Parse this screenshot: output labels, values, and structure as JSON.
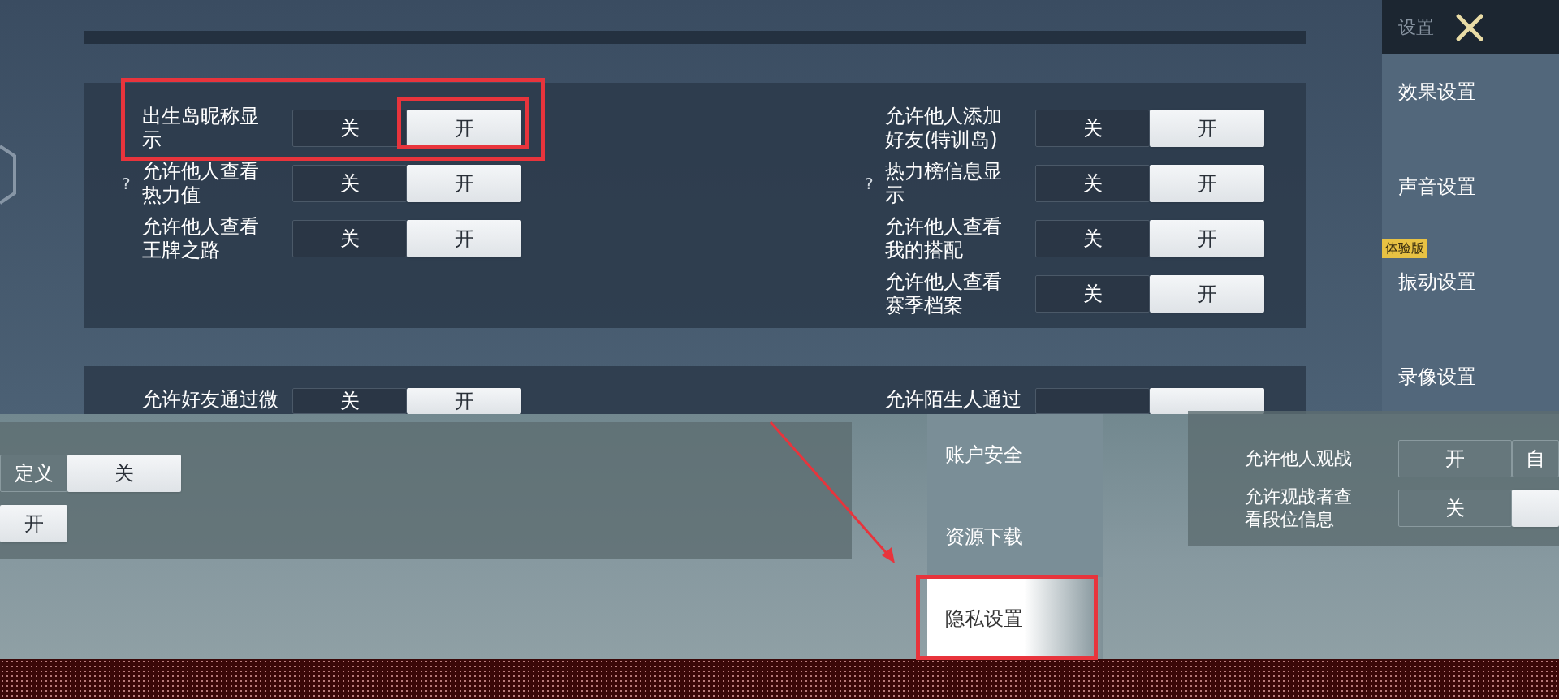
{
  "sidebar": {
    "title": "设置",
    "items": [
      {
        "label": "效果设置",
        "selected": false
      },
      {
        "label": "声音设置",
        "selected": false
      },
      {
        "label": "振动设置",
        "selected": false,
        "badge": "体验版"
      },
      {
        "label": "录像设置",
        "selected": false
      }
    ]
  },
  "privacy_panel": {
    "left_rows": [
      {
        "label": "出生岛昵称显示",
        "options": [
          {
            "label": "关",
            "selected": false
          },
          {
            "label": "开",
            "selected": true
          }
        ]
      },
      {
        "label": "允许他人查看热力值",
        "help": "?",
        "options": [
          {
            "label": "关",
            "selected": false
          },
          {
            "label": "开",
            "selected": true
          }
        ]
      },
      {
        "label": "允许他人查看王牌之路",
        "options": [
          {
            "label": "关",
            "selected": false
          },
          {
            "label": "开",
            "selected": true
          }
        ]
      }
    ],
    "right_rows": [
      {
        "label": "允许他人添加好友(特训岛)",
        "options": [
          {
            "label": "关",
            "selected": false
          },
          {
            "label": "开",
            "selected": true
          }
        ]
      },
      {
        "label": "热力榜信息显示",
        "help": "?",
        "options": [
          {
            "label": "关",
            "selected": false
          },
          {
            "label": "开",
            "selected": true
          }
        ]
      },
      {
        "label": "允许他人查看我的搭配",
        "options": [
          {
            "label": "关",
            "selected": false
          },
          {
            "label": "开",
            "selected": true
          }
        ]
      },
      {
        "label": "允许他人查看赛季档案",
        "options": [
          {
            "label": "关",
            "selected": false
          },
          {
            "label": "开",
            "selected": true
          }
        ]
      }
    ]
  },
  "friends_panel": {
    "left_rows": [
      {
        "label": "允许好友通过微",
        "options": [
          {
            "label": "关",
            "selected": false
          },
          {
            "label": "开",
            "selected": true
          }
        ]
      }
    ],
    "right_rows": [
      {
        "label": "允许陌生人通过",
        "options": [
          {
            "selected": false
          },
          {
            "selected": true
          }
        ]
      }
    ]
  },
  "overlay": {
    "left_panel": {
      "rows": [
        {
          "options": [
            {
              "label": "定义",
              "selected": false
            },
            {
              "label": "关",
              "selected": true
            }
          ]
        },
        {
          "options": [
            {
              "label": "开",
              "selected": true
            }
          ]
        }
      ]
    },
    "menu": [
      {
        "label": "账户安全",
        "selected": false
      },
      {
        "label": "资源下载",
        "selected": false
      },
      {
        "label": "隐私设置",
        "selected": true
      }
    ],
    "right_panel": {
      "rows": [
        {
          "label": "允许他人观战",
          "options": [
            {
              "label": "开",
              "selected": false
            },
            {
              "label": "自",
              "selected": false
            }
          ]
        },
        {
          "label": "允许观战者查看段位信息",
          "options": [
            {
              "label": "关",
              "selected": false
            },
            {
              "selected": true
            }
          ]
        }
      ]
    }
  }
}
